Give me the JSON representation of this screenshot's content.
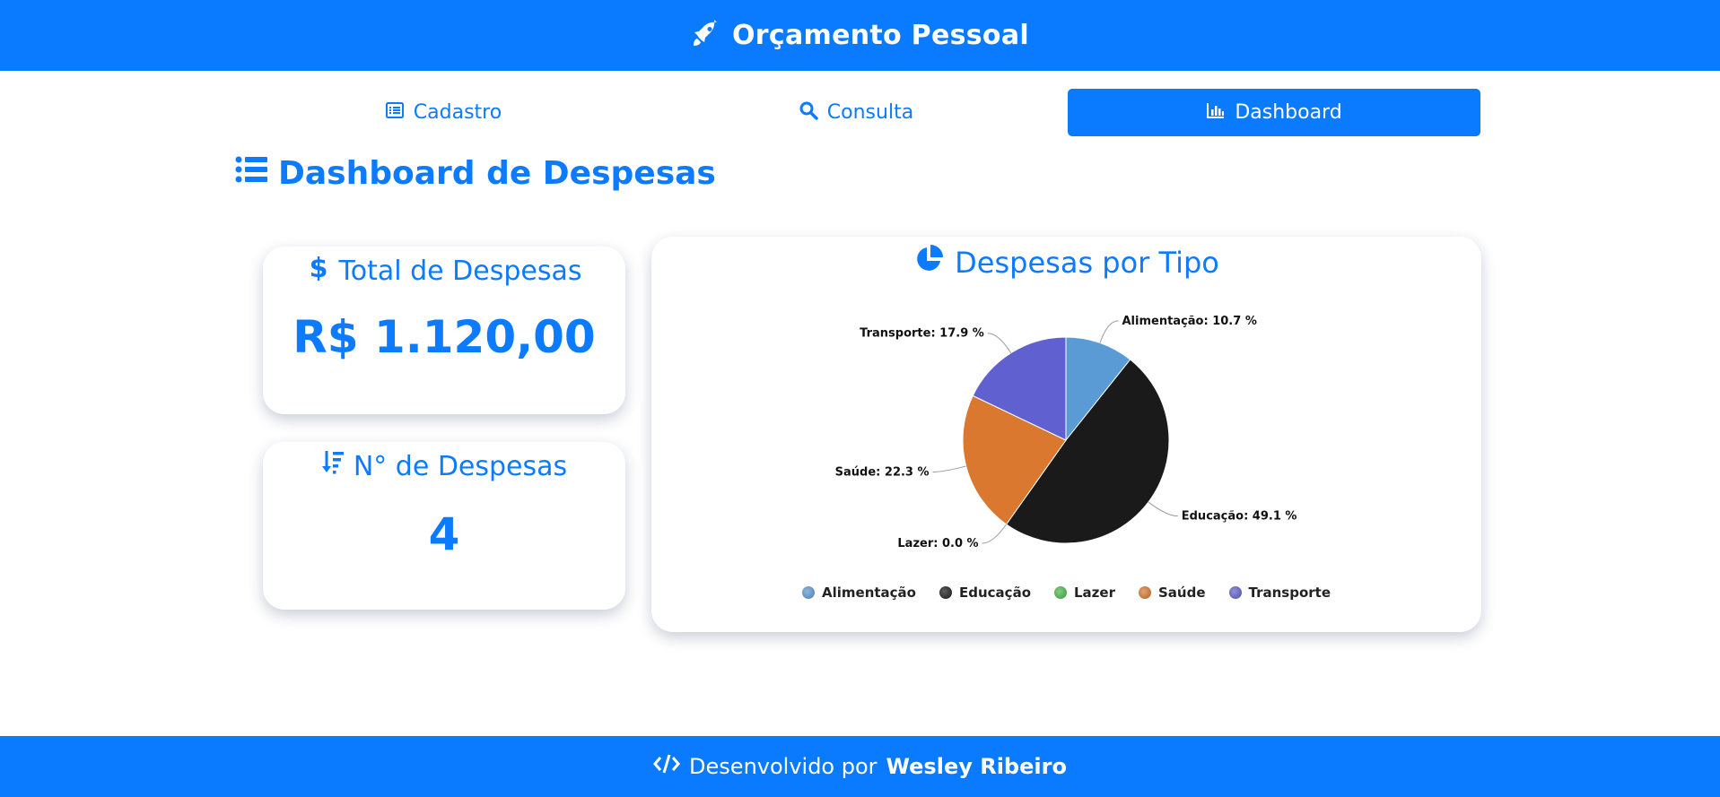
{
  "app": {
    "title": "Orçamento Pessoal",
    "icon": "rocket-icon"
  },
  "nav": {
    "tabs": [
      {
        "label": "Cadastro",
        "icon": "list-alt-icon",
        "active": false
      },
      {
        "label": "Consulta",
        "icon": "search-icon",
        "active": false
      },
      {
        "label": "Dashboard",
        "icon": "bar-chart-icon",
        "active": true
      }
    ]
  },
  "page": {
    "title": "Dashboard de Despesas",
    "icon": "list-icon"
  },
  "cards": {
    "total": {
      "label": "Total de Despesas",
      "value": "R$ 1.120,00",
      "icon": "dollar-icon"
    },
    "count": {
      "label": "N° de Despesas",
      "value": "4",
      "icon": "sort-amount-icon"
    }
  },
  "chart": {
    "title": "Despesas por Tipo",
    "icon": "pie-chart-icon"
  },
  "chart_data": {
    "type": "pie",
    "title": "Despesas por Tipo",
    "categories": [
      "Alimentação",
      "Educação",
      "Lazer",
      "Saúde",
      "Transporte"
    ],
    "values": [
      10.7,
      49.1,
      0.0,
      22.3,
      17.9
    ],
    "labels": [
      "Alimentação: 10.7 %",
      "Educação: 49.1 %",
      "Lazer: 0.0 %",
      "Saúde: 22.3 %",
      "Transporte: 17.9 %"
    ],
    "colors": [
      "#5b9bd5",
      "#1a1a1a",
      "#4cba4a",
      "#d9782e",
      "#6060d0"
    ],
    "legend": "bottom"
  },
  "footer": {
    "prefix": "Desenvolvido por",
    "author": "Wesley Ribeiro",
    "icon": "code-icon"
  },
  "colors": {
    "primary": "#0a7bff",
    "text_primary": "#0d7bff"
  }
}
